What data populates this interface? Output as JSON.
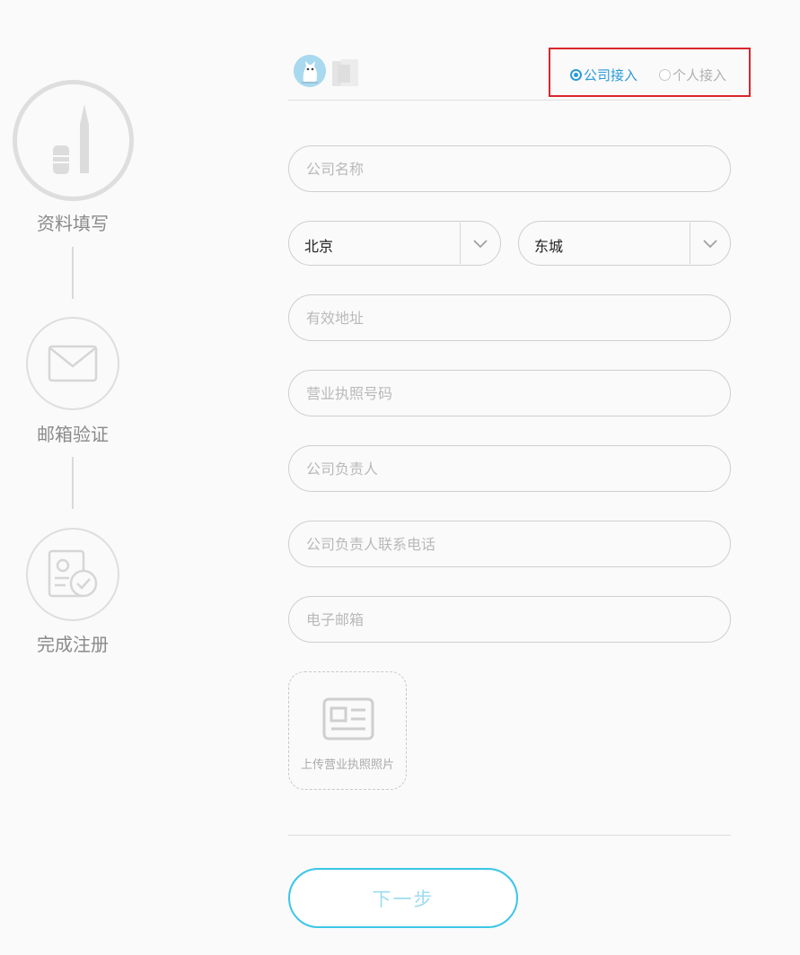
{
  "steps": [
    {
      "label": "资料填写",
      "icon": "pen-icon",
      "state": "active"
    },
    {
      "label": "邮箱验证",
      "icon": "envelope-icon",
      "state": "pending"
    },
    {
      "label": "完成注册",
      "icon": "certificate-check-icon",
      "state": "pending"
    }
  ],
  "access_type": {
    "company_label": "公司接入",
    "personal_label": "个人接入",
    "selected": "company"
  },
  "form": {
    "company_name_placeholder": "公司名称",
    "province_value": "北京",
    "district_value": "东城",
    "address_placeholder": "有效地址",
    "license_number_placeholder": "营业执照号码",
    "manager_placeholder": "公司负责人",
    "manager_phone_placeholder": "公司负责人联系电话",
    "email_placeholder": "电子邮箱",
    "upload_label": "上传营业执照照片",
    "next_label": "下一步"
  },
  "colors": {
    "accent": "#2b9ad9",
    "highlight_box": "#d9262c",
    "button_border": "#3cc6e8"
  }
}
